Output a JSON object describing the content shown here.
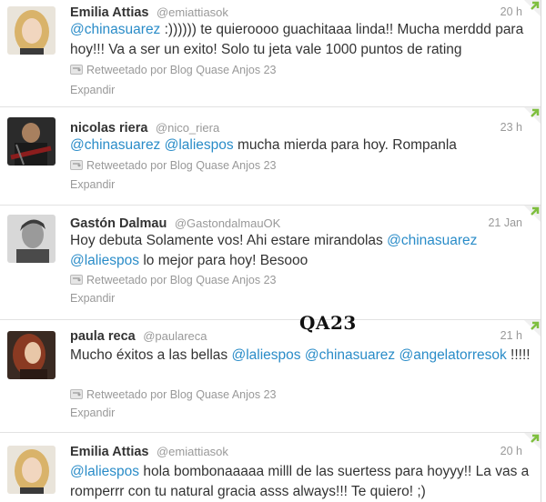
{
  "retweet_label": "Retweetado por Blog Quase Anjos 23",
  "expand_label": "Expandir",
  "watermark": "QA23",
  "colors": {
    "link": "#2a8cc8",
    "muted": "#999999",
    "text": "#333333",
    "corner": "#7fbf3f"
  },
  "tweets": [
    {
      "name": "Emilia Attias",
      "handle": "@emiattiasok",
      "time": "20 h",
      "avatar": "woman-blonde-avatar",
      "segments": [
        {
          "t": "@chinasuarez",
          "m": true
        },
        {
          "t": " :)))))) te quieroooo guachitaaa linda!! Mucha merddd para hoy!!! Va a ser un exito! Solo tu jeta vale 1000 puntos de rating",
          "m": false
        }
      ]
    },
    {
      "name": "nicolas riera",
      "handle": "@nico_riera",
      "time": "23 h",
      "avatar": "man-guitar-avatar",
      "segments": [
        {
          "t": "@chinasuarez",
          "m": true
        },
        {
          "t": " ",
          "m": false
        },
        {
          "t": "@laliespos",
          "m": true
        },
        {
          "t": " mucha mierda para hoy. Rompanla",
          "m": false
        }
      ]
    },
    {
      "name": "Gastón Dalmau",
      "handle": "@GastondalmauOK",
      "time": "21 Jan",
      "avatar": "man-bw-avatar",
      "segments": [
        {
          "t": "Hoy debuta Solamente vos! Ahi estare mirandolas ",
          "m": false
        },
        {
          "t": "@chinasuarez",
          "m": true
        },
        {
          "t": " ",
          "m": false
        },
        {
          "t": "@laliespos",
          "m": true
        },
        {
          "t": " lo mejor para hoy! Besooo",
          "m": false
        }
      ]
    },
    {
      "name": "paula reca",
      "handle": "@paulareca",
      "time": "21 h",
      "avatar": "woman-redhair-avatar",
      "segments": [
        {
          "t": "Mucho éxitos a las bellas ",
          "m": false
        },
        {
          "t": "@laliespos",
          "m": true
        },
        {
          "t": " ",
          "m": false
        },
        {
          "t": "@chinasuarez",
          "m": true
        },
        {
          "t": " ",
          "m": false
        },
        {
          "t": "@angelatorresok",
          "m": true
        },
        {
          "t": " !!!!!",
          "m": false
        }
      ]
    },
    {
      "name": "Emilia Attias",
      "handle": "@emiattiasok",
      "time": "20 h",
      "avatar": "woman-blonde-avatar",
      "segments": [
        {
          "t": "@laliespos",
          "m": true
        },
        {
          "t": " hola bombonaaaaa milll de las suertess para hoyyy!! La vas a romperrr con tu natural gracia asss always!!! Te quiero! ;)",
          "m": false
        }
      ]
    }
  ]
}
